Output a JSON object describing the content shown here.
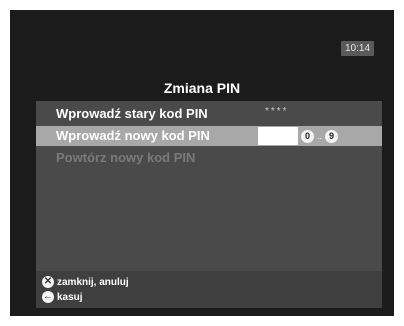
{
  "clock": "10:14",
  "title": "Zmiana PIN",
  "rows": [
    {
      "label": "Wprowadź stary kod PIN",
      "value": "****"
    },
    {
      "label": "Wprowadź nowy kod PIN",
      "value": ""
    },
    {
      "label": "Powtórz nowy kod PIN",
      "value": ""
    }
  ],
  "digit_hint": {
    "from": "0",
    "separator": "..",
    "to": "9"
  },
  "footer": {
    "close_label": "zamknij, anuluj",
    "close_icon": "close-x-icon",
    "delete_label": "kasuj",
    "delete_icon": "back-arrow-icon"
  },
  "colors": {
    "background": "#1b1b1b",
    "panel": "#4a4a4a",
    "highlight": "#a8a8a8",
    "disabled_text": "#7a7a7a"
  }
}
